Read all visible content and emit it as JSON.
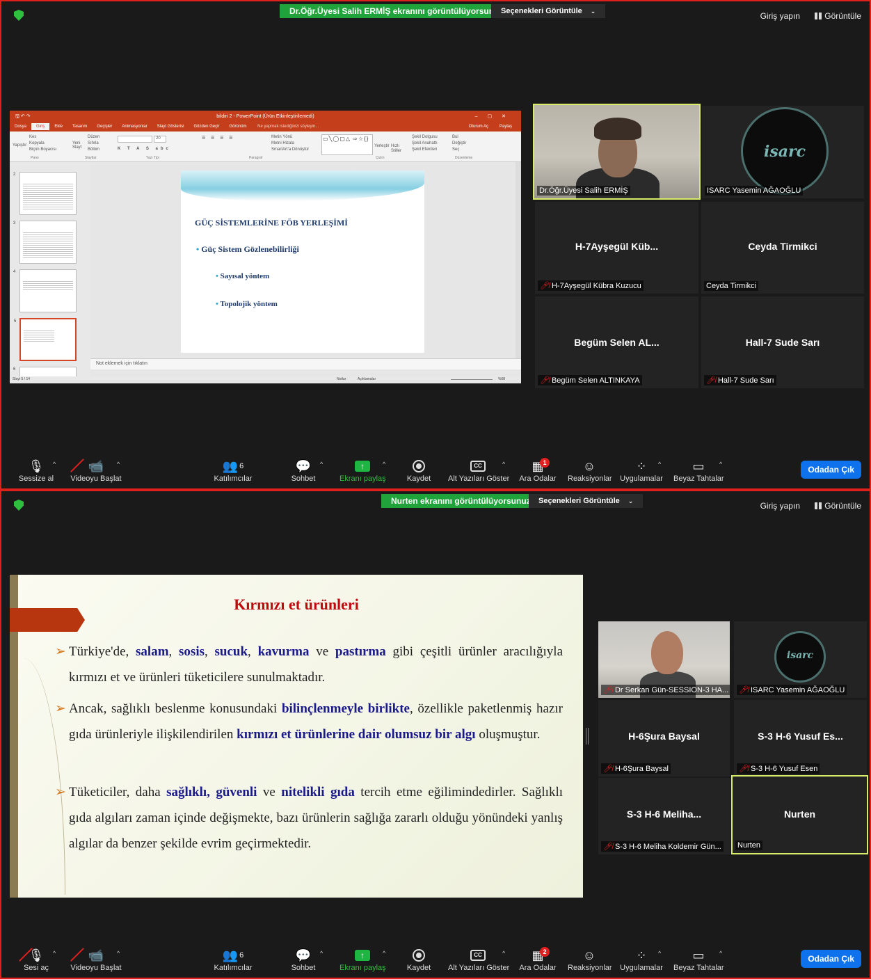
{
  "panel1": {
    "banner": "Dr.Öğr.Üyesi Salih ERMİŞ ekranını görüntülüyorsunuz",
    "view_options": "Seçenekleri Görüntüle",
    "signin": "Giriş yapın",
    "view": "Görüntüle",
    "ppt": {
      "title": "bildiri 2 - PowerPoint (Ürün Etkinleştirilemedi)",
      "tabs": [
        "Dosya",
        "Giriş",
        "Ekle",
        "Tasarım",
        "Geçişler",
        "Animasyonlar",
        "Slayt Gösterisi",
        "Gözden Geçir",
        "Görünüm"
      ],
      "tell_me": "Ne yapmak istediğinizi söyleyin...",
      "account": "Oturum Aç",
      "share": "Paylaş",
      "ribbon": {
        "cut": "Kes",
        "copy": "Kopyala",
        "painter": "Biçim Boyacısı",
        "paste": "Yapıştır",
        "new_slide": "Yeni Slayt",
        "layout": "Düzen",
        "reset": "Sıfırla",
        "section": "Bölüm",
        "text_dir": "Metin Yönü",
        "align_text": "Metni Hizala",
        "smartart": "SmartArt'a Dönüştür",
        "arrange": "Yerleştir",
        "quick_styles": "Hızlı Stiller",
        "shape_fill": "Şekil Dolgusu",
        "shape_outline": "Şekil Anahattı",
        "shape_effects": "Şekil Efektleri",
        "find": "Bul",
        "replace": "Değiştir",
        "select": "Seç",
        "font_size": "20",
        "groups": [
          "Pano",
          "Slaytlar",
          "Yazı Tipi",
          "Paragraf",
          "Çizim",
          "Düzenleme"
        ]
      },
      "thumb_numbers": [
        "2",
        "3",
        "4",
        "5",
        "6"
      ],
      "slide": {
        "title": "GÜÇ SİSTEMLERİNE FÖB YERLEŞİMİ",
        "bullet1": "Güç Sistem Gözlenebilirliği",
        "bullet2": "Sayısal yöntem",
        "bullet3": "Topolojik yöntem"
      },
      "notes_placeholder": "Not eklemek için tıklatın",
      "status_slide": "Slayt 5 / 14",
      "status_notes": "Notlar",
      "status_comments": "Açıklamalar",
      "zoom": "%68"
    },
    "tiles": [
      {
        "name": "",
        "label": "Dr.Öğr.Üyesi Salih ERMİŞ",
        "muted": false
      },
      {
        "name": "",
        "label": "ISARC Yasemin AĞAOĞLU",
        "muted": false
      },
      {
        "name": "H-7Ayşegül Küb...",
        "label": "H-7Ayşegül Kübra Kuzucu",
        "muted": true
      },
      {
        "name": "Ceyda Tirmikci",
        "label": "Ceyda Tirmikci",
        "muted": false
      },
      {
        "name": "Begüm Selen AL...",
        "label": "Begüm Selen ALTINKAYA",
        "muted": true
      },
      {
        "name": "Hall-7 Sude Sarı",
        "label": "Hall-7 Sude Sarı",
        "muted": true
      }
    ],
    "toolbar": {
      "mute": "Sessize al",
      "video": "Videoyu Başlat",
      "participants": "Katılımcılar",
      "participants_count": "6",
      "chat": "Sohbet",
      "share": "Ekranı paylaş",
      "record": "Kaydet",
      "captions": "Alt Yazıları Göster",
      "breakout": "Ara Odalar",
      "breakout_badge": "1",
      "reactions": "Reaksiyonlar",
      "apps": "Uygulamalar",
      "whiteboard": "Beyaz Tahtalar",
      "leave": "Odadan Çık"
    }
  },
  "panel2": {
    "banner": "Nurten ekranını görüntülüyorsunuz",
    "view_options": "Seçenekleri Görüntüle",
    "signin": "Giriş yapın",
    "view": "Görüntüle",
    "slide": {
      "title": "Kırmızı et ürünleri",
      "p1": [
        "Türkiye'de, ",
        "salam",
        ", ",
        "sosis",
        ", ",
        "sucuk",
        ", ",
        "kavurma",
        " ve ",
        "pastırma",
        " gibi çeşitli ürünler aracılığıyla kırmızı et ve ürünleri tüketicilere sunulmaktadır."
      ],
      "p2": [
        "Ancak, sağlıklı beslenme konusundaki ",
        "bilinçlenmeyle birlikte",
        ", özellikle paketlenmiş hazır gıda ürünleriyle ilişkilendirilen ",
        "kırmızı et ürünlerine dair olumsuz bir algı",
        " oluşmuştur."
      ],
      "p3": [
        "Tüketiciler, daha ",
        "sağlıklı, güvenli",
        " ve ",
        "nitelikli gıda",
        " tercih etme eğilimindedirler. Sağlıklı gıda algıları zaman içinde değişmekte, bazı ürünlerin sağlığa zararlı olduğu yönündeki yanlış algılar da benzer şekilde evrim geçirmektedir."
      ]
    },
    "tiles": [
      {
        "name": "",
        "label": "Dr Serkan Gün-SESSION-3 HA...",
        "muted": true
      },
      {
        "name": "",
        "label": "ISARC Yasemin AĞAOĞLU",
        "muted": true
      },
      {
        "name": "H-6Şura Baysal",
        "label": "H-6Şura Baysal",
        "muted": true
      },
      {
        "name": "S-3 H-6 Yusuf Es...",
        "label": "S-3 H-6 Yusuf Esen",
        "muted": true
      },
      {
        "name": "S-3 H-6 Meliha...",
        "label": "S-3 H-6 Meliha Koldemir Gün...",
        "muted": true
      },
      {
        "name": "Nurten",
        "label": "Nurten",
        "muted": false
      }
    ],
    "toolbar": {
      "mute": "Sesi aç",
      "video": "Videoyu Başlat",
      "participants": "Katılımcılar",
      "participants_count": "6",
      "chat": "Sohbet",
      "share": "Ekranı paylaş",
      "record": "Kaydet",
      "captions": "Alt Yazıları Göster",
      "breakout": "Ara Odalar",
      "breakout_badge": "2",
      "reactions": "Reaksiyonlar",
      "apps": "Uygulamalar",
      "whiteboard": "Beyaz Tahtalar",
      "leave": "Odadan Çık"
    }
  },
  "colors": {
    "border": "#e0201a",
    "banner": "#1fa33a",
    "leave": "#0e72ed",
    "active_speaker": "#d8ec6a",
    "slide2_title": "#c0080f",
    "slide2_highlight": "#1a1a8a"
  },
  "icons": {
    "shield": "shield-icon",
    "mic": "microphone-icon",
    "video": "video-camera-icon",
    "participants": "people-icon",
    "chat": "chat-bubble-icon",
    "share": "share-screen-icon",
    "record": "record-icon",
    "captions": "cc-icon",
    "breakout": "breakout-rooms-icon",
    "reactions": "smiley-plus-icon",
    "apps": "apps-icon",
    "whiteboard": "whiteboard-icon"
  }
}
